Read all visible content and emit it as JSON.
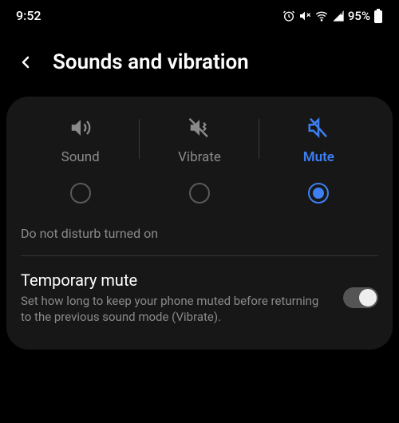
{
  "status": {
    "time": "9:52",
    "battery": "95%"
  },
  "header": {
    "title": "Sounds and vibration"
  },
  "modes": {
    "sound": {
      "label": "Sound"
    },
    "vibrate": {
      "label": "Vibrate"
    },
    "mute": {
      "label": "Mute"
    }
  },
  "dnd_text": "Do not disturb turned on",
  "temporary_mute": {
    "title": "Temporary mute",
    "description": "Set how long to keep your phone muted before returning to the previous sound mode (Vibrate)."
  }
}
